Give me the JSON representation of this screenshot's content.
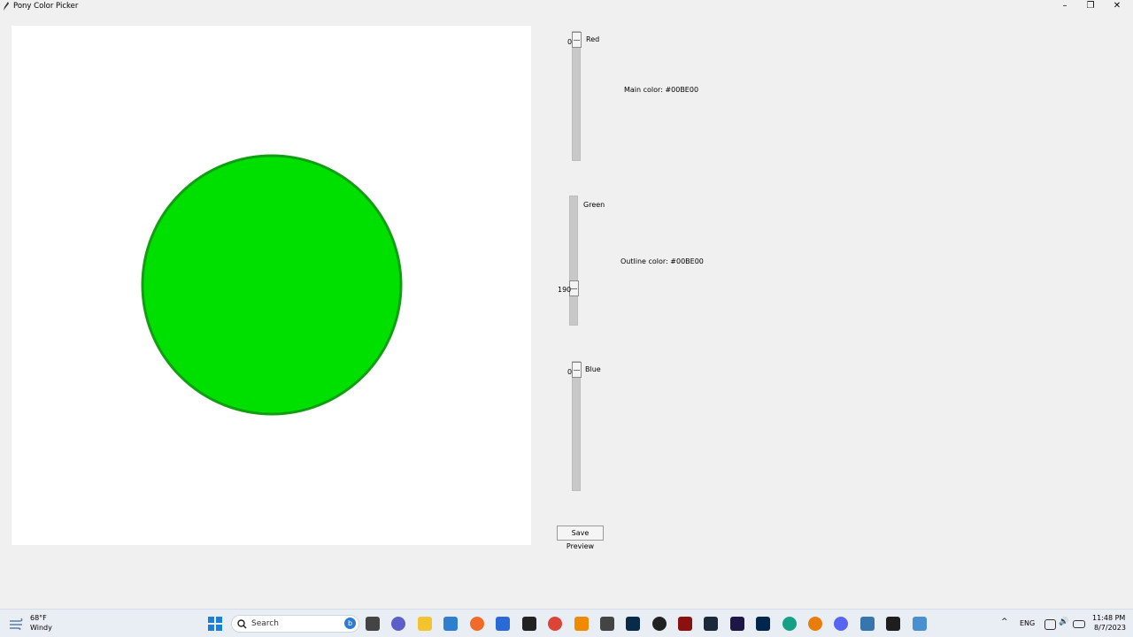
{
  "window": {
    "title": "Pony Color Picker"
  },
  "sliders": {
    "red": {
      "label": "Red",
      "value": "0",
      "level": 0
    },
    "green": {
      "label": "Green",
      "value": "190",
      "level": 0.745
    },
    "blue": {
      "label": "Blue",
      "value": "0",
      "level": 0
    }
  },
  "main_color": "Main color: #00BE00",
  "outline_color": "Outline color: #00BE00",
  "colors": {
    "fill": "#00e000",
    "outline": "#129e12"
  },
  "save_label": "Save Preview",
  "taskbar": {
    "weather_temp": "68°F",
    "weather_desc": "Windy",
    "search_placeholder": "Search",
    "lang": "ENG",
    "time": "11:48 PM",
    "date": "8/7/2023",
    "apps": [
      "windows-start-icon",
      "task-view-icon",
      "chat-icon",
      "file-explorer-icon",
      "store-icon",
      "firefox-icon",
      "dropbox-icon",
      "app-icon",
      "chrome-icon",
      "vlc-icon",
      "inkscape-icon",
      "photoshop-icon",
      "obs-icon",
      "flash-icon",
      "media-encoder-icon",
      "after-effects-icon",
      "audition-icon",
      "person-icon",
      "blender-icon",
      "discord-icon",
      "python-icon",
      "terminal-icon",
      "python-app-icon"
    ]
  }
}
